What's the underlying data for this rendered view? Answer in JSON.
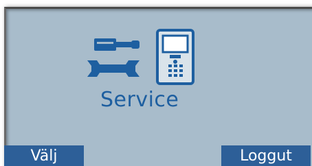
{
  "screen": {
    "title": "Service",
    "icons": [
      "tools-icon",
      "payment-terminal-icon"
    ],
    "colors": {
      "background": "#a8bccb",
      "accent": "#1e5fa0",
      "softkey": "#2d5f98"
    }
  },
  "softkeys": {
    "left_label": "Välj",
    "right_label": "Loggut"
  }
}
